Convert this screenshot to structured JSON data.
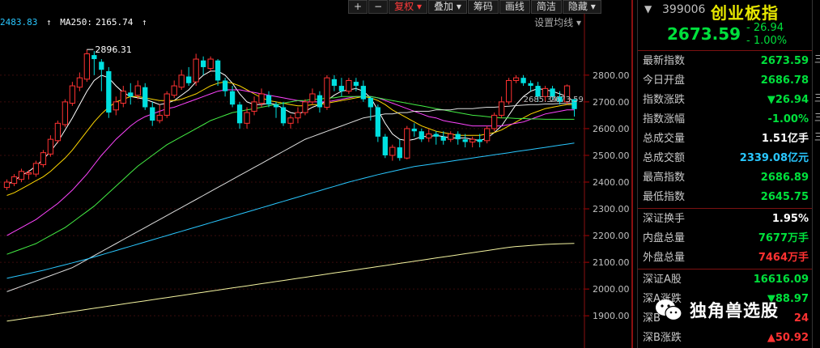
{
  "toolbar": {
    "plus": "+",
    "minus": "−",
    "restore_rights": "复权",
    "overlay": "叠加",
    "chips": "筹码",
    "simple": "简洁",
    "draw": "画线",
    "hide": "隐藏"
  },
  "ma_legend": {
    "first_value": "2483.83",
    "ma250_label": "MA250:",
    "ma250_value": "2165.74",
    "arrow": "↑"
  },
  "settings_label": "设置均线",
  "chart_data": {
    "type": "candlestick",
    "ylim": [
      1840,
      2960
    ],
    "y_ticks": [
      "2800.00",
      "2700.00",
      "2600.00",
      "2500.00",
      "2400.00",
      "2300.00",
      "2200.00",
      "2100.00",
      "2000.00",
      "1900.00"
    ],
    "y_tick_values": [
      2800,
      2700,
      2600,
      2500,
      2400,
      2300,
      2200,
      2100,
      2000,
      1900
    ],
    "high_label": "2896.31",
    "mid_label": "2685.34",
    "last_label": "2673.59",
    "candles": [
      [
        2380,
        2400,
        2370,
        2410
      ],
      [
        2395,
        2420,
        2385,
        2430
      ],
      [
        2410,
        2440,
        2400,
        2450
      ],
      [
        2430,
        2435,
        2410,
        2445
      ],
      [
        2430,
        2470,
        2420,
        2480
      ],
      [
        2465,
        2510,
        2455,
        2520
      ],
      [
        2505,
        2560,
        2495,
        2575
      ],
      [
        2555,
        2620,
        2545,
        2630
      ],
      [
        2615,
        2700,
        2605,
        2710
      ],
      [
        2695,
        2760,
        2685,
        2775
      ],
      [
        2755,
        2790,
        2740,
        2810
      ],
      [
        2785,
        2880,
        2775,
        2896
      ],
      [
        2875,
        2860,
        2800,
        2890
      ],
      [
        2850,
        2820,
        2740,
        2860
      ],
      [
        2815,
        2660,
        2640,
        2830
      ],
      [
        2670,
        2700,
        2650,
        2720
      ],
      [
        2695,
        2740,
        2680,
        2760
      ],
      [
        2735,
        2720,
        2690,
        2770
      ],
      [
        2725,
        2760,
        2710,
        2780
      ],
      [
        2755,
        2680,
        2670,
        2770
      ],
      [
        2680,
        2630,
        2610,
        2700
      ],
      [
        2630,
        2650,
        2620,
        2690
      ],
      [
        2650,
        2730,
        2640,
        2740
      ],
      [
        2725,
        2760,
        2715,
        2780
      ],
      [
        2755,
        2800,
        2745,
        2820
      ],
      [
        2795,
        2770,
        2760,
        2830
      ],
      [
        2775,
        2860,
        2760,
        2880
      ],
      [
        2855,
        2830,
        2800,
        2870
      ],
      [
        2825,
        2860,
        2815,
        2870
      ],
      [
        2855,
        2780,
        2760,
        2860
      ],
      [
        2780,
        2740,
        2720,
        2790
      ],
      [
        2740,
        2690,
        2680,
        2760
      ],
      [
        2690,
        2620,
        2600,
        2700
      ],
      [
        2620,
        2660,
        2600,
        2680
      ],
      [
        2665,
        2700,
        2650,
        2720
      ],
      [
        2695,
        2730,
        2680,
        2750
      ],
      [
        2725,
        2690,
        2680,
        2740
      ],
      [
        2690,
        2680,
        2640,
        2700
      ],
      [
        2680,
        2620,
        2610,
        2700
      ],
      [
        2620,
        2640,
        2600,
        2650
      ],
      [
        2640,
        2660,
        2620,
        2680
      ],
      [
        2660,
        2700,
        2650,
        2710
      ],
      [
        2700,
        2730,
        2690,
        2750
      ],
      [
        2725,
        2680,
        2660,
        2740
      ],
      [
        2680,
        2790,
        2670,
        2800
      ],
      [
        2785,
        2760,
        2740,
        2800
      ],
      [
        2760,
        2740,
        2720,
        2790
      ],
      [
        2740,
        2780,
        2730,
        2790
      ],
      [
        2775,
        2760,
        2740,
        2790
      ],
      [
        2760,
        2710,
        2700,
        2780
      ],
      [
        2715,
        2680,
        2630,
        2720
      ],
      [
        2680,
        2570,
        2550,
        2690
      ],
      [
        2570,
        2500,
        2490,
        2580
      ],
      [
        2500,
        2530,
        2480,
        2540
      ],
      [
        2530,
        2490,
        2480,
        2560
      ],
      [
        2490,
        2600,
        2485,
        2610
      ],
      [
        2600,
        2590,
        2570,
        2620
      ],
      [
        2590,
        2560,
        2550,
        2600
      ],
      [
        2565,
        2580,
        2550,
        2600
      ],
      [
        2580,
        2570,
        2540,
        2590
      ],
      [
        2570,
        2555,
        2540,
        2590
      ],
      [
        2560,
        2580,
        2550,
        2590
      ],
      [
        2580,
        2560,
        2540,
        2590
      ],
      [
        2560,
        2550,
        2530,
        2580
      ],
      [
        2550,
        2560,
        2530,
        2570
      ],
      [
        2560,
        2550,
        2530,
        2580
      ],
      [
        2555,
        2600,
        2545,
        2610
      ],
      [
        2600,
        2650,
        2590,
        2660
      ],
      [
        2650,
        2700,
        2640,
        2720
      ],
      [
        2700,
        2780,
        2690,
        2790
      ],
      [
        2780,
        2790,
        2770,
        2800
      ],
      [
        2790,
        2770,
        2760,
        2800
      ],
      [
        2770,
        2760,
        2740,
        2780
      ],
      [
        2760,
        2720,
        2700,
        2775
      ],
      [
        2720,
        2750,
        2700,
        2760
      ],
      [
        2750,
        2720,
        2710,
        2760
      ],
      [
        2720,
        2700,
        2690,
        2740
      ],
      [
        2700,
        2760,
        2690,
        2765
      ],
      [
        2710,
        2673,
        2645,
        2686
      ]
    ],
    "ma_lines": [
      {
        "color": "#ffffff",
        "values": [
          2390,
          2405,
          2425,
          2440,
          2460,
          2485,
          2515,
          2550,
          2595,
          2640,
          2690,
          2740,
          2780,
          2800,
          2790,
          2760,
          2735,
          2720,
          2715,
          2710,
          2700,
          2690,
          2695,
          2705,
          2725,
          2745,
          2775,
          2800,
          2815,
          2815,
          2800,
          2770,
          2730,
          2700,
          2690,
          2690,
          2695,
          2690,
          2675,
          2660,
          2655,
          2665,
          2680,
          2690,
          2705,
          2725,
          2740,
          2745,
          2750,
          2740,
          2715,
          2670,
          2620,
          2580,
          2560,
          2555,
          2560,
          2570,
          2570,
          2575,
          2570,
          2565,
          2565,
          2565,
          2560,
          2555,
          2565,
          2585,
          2610,
          2650,
          2690,
          2720,
          2740,
          2750,
          2745,
          2740,
          2730,
          2720,
          2700
        ]
      },
      {
        "color": "#ffd700",
        "values": [
          2350,
          2360,
          2375,
          2390,
          2405,
          2420,
          2440,
          2465,
          2490,
          2520,
          2555,
          2590,
          2625,
          2655,
          2680,
          2700,
          2710,
          2720,
          2720,
          2715,
          2710,
          2705,
          2705,
          2705,
          2710,
          2720,
          2730,
          2745,
          2760,
          2770,
          2775,
          2770,
          2760,
          2745,
          2730,
          2715,
          2705,
          2700,
          2695,
          2690,
          2685,
          2685,
          2690,
          2690,
          2695,
          2700,
          2705,
          2710,
          2715,
          2720,
          2715,
          2705,
          2690,
          2670,
          2655,
          2640,
          2625,
          2610,
          2600,
          2590,
          2585,
          2580,
          2575,
          2575,
          2575,
          2575,
          2580,
          2585,
          2595,
          2610,
          2625,
          2640,
          2655,
          2665,
          2675,
          2680,
          2685,
          2690,
          2690
        ]
      },
      {
        "color": "#ff44ff",
        "values": [
          2200,
          2215,
          2230,
          2245,
          2260,
          2280,
          2300,
          2320,
          2345,
          2370,
          2400,
          2430,
          2465,
          2500,
          2530,
          2560,
          2585,
          2610,
          2630,
          2645,
          2655,
          2665,
          2675,
          2680,
          2690,
          2700,
          2710,
          2720,
          2730,
          2740,
          2745,
          2745,
          2745,
          2740,
          2735,
          2730,
          2725,
          2720,
          2715,
          2710,
          2705,
          2700,
          2700,
          2700,
          2700,
          2705,
          2710,
          2715,
          2720,
          2720,
          2720,
          2715,
          2705,
          2695,
          2685,
          2675,
          2665,
          2655,
          2645,
          2640,
          2630,
          2625,
          2620,
          2615,
          2610,
          2610,
          2610,
          2610,
          2610,
          2615,
          2620,
          2625,
          2635,
          2645,
          2655,
          2660,
          2665,
          2670,
          2670
        ]
      },
      {
        "color": "#44ee44",
        "values": [
          2130,
          2140,
          2150,
          2160,
          2170,
          2185,
          2200,
          2215,
          2230,
          2250,
          2270,
          2290,
          2310,
          2335,
          2360,
          2385,
          2410,
          2435,
          2460,
          2480,
          2500,
          2520,
          2540,
          2555,
          2570,
          2585,
          2600,
          2615,
          2630,
          2640,
          2650,
          2660,
          2665,
          2670,
          2675,
          2680,
          2685,
          2690,
          2695,
          2700,
          2705,
          2705,
          2710,
          2710,
          2715,
          2715,
          2720,
          2720,
          2720,
          2720,
          2720,
          2715,
          2710,
          2705,
          2700,
          2695,
          2690,
          2685,
          2680,
          2675,
          2670,
          2665,
          2660,
          2655,
          2650,
          2648,
          2645,
          2642,
          2640,
          2640,
          2638,
          2638,
          2636,
          2636,
          2635,
          2635,
          2635,
          2635,
          2635
        ]
      },
      {
        "color": "#dddddd",
        "values": [
          1990,
          2000,
          2010,
          2020,
          2030,
          2040,
          2050,
          2060,
          2070,
          2080,
          2095,
          2110,
          2125,
          2140,
          2155,
          2170,
          2185,
          2200,
          2215,
          2230,
          2245,
          2260,
          2275,
          2290,
          2305,
          2320,
          2335,
          2350,
          2365,
          2380,
          2395,
          2410,
          2425,
          2440,
          2455,
          2470,
          2485,
          2500,
          2515,
          2530,
          2545,
          2560,
          2570,
          2580,
          2590,
          2600,
          2610,
          2620,
          2630,
          2640,
          2645,
          2650,
          2655,
          2655,
          2660,
          2660,
          2665,
          2665,
          2665,
          2670,
          2670,
          2670,
          2675,
          2675,
          2675,
          2678,
          2680,
          2680,
          2682,
          2684,
          2686,
          2688,
          2690,
          2690,
          2692,
          2692,
          2694,
          2694,
          2695
        ]
      },
      {
        "color": "#29c7ff",
        "values": [
          2040,
          2046,
          2052,
          2058,
          2064,
          2070,
          2077,
          2084,
          2091,
          2098,
          2105,
          2112,
          2120,
          2128,
          2136,
          2144,
          2152,
          2160,
          2168,
          2176,
          2184,
          2192,
          2200,
          2208,
          2216,
          2224,
          2232,
          2240,
          2248,
          2256,
          2264,
          2272,
          2280,
          2288,
          2296,
          2304,
          2312,
          2320,
          2328,
          2336,
          2344,
          2352,
          2360,
          2368,
          2376,
          2384,
          2392,
          2400,
          2407,
          2414,
          2421,
          2428,
          2434,
          2440,
          2446,
          2452,
          2458,
          2462,
          2466,
          2470,
          2474,
          2478,
          2482,
          2486,
          2490,
          2494,
          2498,
          2502,
          2506,
          2510,
          2514,
          2518,
          2522,
          2526,
          2530,
          2534,
          2538,
          2542,
          2546
        ]
      },
      {
        "color": "#f4f4a0",
        "values": [
          1880,
          1884,
          1888,
          1892,
          1896,
          1900,
          1904,
          1908,
          1912,
          1916,
          1920,
          1924,
          1928,
          1932,
          1936,
          1940,
          1944,
          1948,
          1952,
          1956,
          1960,
          1964,
          1968,
          1972,
          1976,
          1980,
          1984,
          1988,
          1992,
          1996,
          2000,
          2004,
          2008,
          2012,
          2016,
          2020,
          2024,
          2028,
          2032,
          2036,
          2040,
          2044,
          2048,
          2052,
          2056,
          2060,
          2064,
          2068,
          2072,
          2076,
          2080,
          2084,
          2088,
          2092,
          2096,
          2100,
          2104,
          2108,
          2112,
          2116,
          2120,
          2124,
          2128,
          2132,
          2136,
          2140,
          2144,
          2148,
          2152,
          2156,
          2159,
          2161,
          2163,
          2165,
          2167,
          2168,
          2169,
          2170,
          2171
        ]
      }
    ]
  },
  "panel": {
    "code": "399006",
    "name": "创业板指",
    "price": "2673.59",
    "change": "- 26.94",
    "change_pct": "- 1.00%",
    "rows": [
      {
        "label": "最新指数",
        "value": "2673.59",
        "cls": "green"
      },
      {
        "label": "今日开盘",
        "value": "2686.78",
        "cls": "green"
      },
      {
        "label": "指数涨跌",
        "value": "▼26.94",
        "cls": "green"
      },
      {
        "label": "指数涨幅",
        "value": "-1.00%",
        "cls": "green"
      },
      {
        "label": "总成交量",
        "value": "1.51亿手",
        "cls": "white"
      },
      {
        "label": "总成交额",
        "value": "2339.08亿元",
        "cls": "cyan"
      },
      {
        "label": "最高指数",
        "value": "2686.89",
        "cls": "green"
      },
      {
        "label": "最低指数",
        "value": "2645.75",
        "cls": "green"
      }
    ],
    "rows2": [
      {
        "label": "深证换手",
        "value": "1.95%",
        "cls": "white"
      },
      {
        "label": "内盘总量",
        "value": "7677万手",
        "cls": "green"
      },
      {
        "label": "外盘总量",
        "value": "7464万手",
        "cls": "red"
      }
    ],
    "rows3": [
      {
        "label": "深证A股",
        "value": "16616.09",
        "cls": "green"
      },
      {
        "label": "深A涨跌",
        "value": "▼88.97",
        "cls": "green"
      },
      {
        "label": "深B",
        "value": "24",
        "cls": "red"
      },
      {
        "label": "深B涨跌",
        "value": "▲50.92",
        "cls": "red"
      }
    ]
  },
  "watermark": {
    "text": "独角兽选股"
  }
}
